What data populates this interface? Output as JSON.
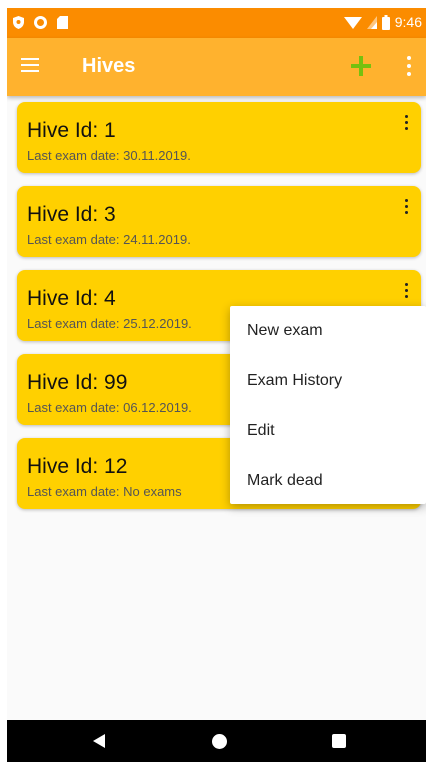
{
  "status_bar": {
    "time": "9:46",
    "icons": [
      "shield-icon",
      "circle-icon",
      "sd-card-icon",
      "wifi-icon",
      "signal-icon",
      "battery-icon"
    ]
  },
  "app_bar": {
    "title": "Hives",
    "icons": [
      "menu-icon",
      "add-icon",
      "overflow-menu-icon"
    ]
  },
  "colors": {
    "status_bar": "#fb8c00",
    "app_bar": "#ffb22e",
    "card": "#ffd000",
    "add_icon": "#76c10f"
  },
  "hives": [
    {
      "title": "Hive Id: 1",
      "last_exam": "Last exam date: 30.11.2019."
    },
    {
      "title": "Hive Id: 3",
      "last_exam": "Last exam date: 24.11.2019."
    },
    {
      "title": "Hive Id: 4",
      "last_exam": "Last exam date: 25.12.2019."
    },
    {
      "title": "Hive Id: 99",
      "last_exam": "Last exam date: 06.12.2019."
    },
    {
      "title": "Hive Id: 12",
      "last_exam": "Last exam date: No exams"
    }
  ],
  "popup_menu": {
    "items": [
      "New exam",
      "Exam History",
      "Edit",
      "Mark dead"
    ]
  },
  "nav_bar": {
    "icons": [
      "back-icon",
      "home-icon",
      "recent-apps-icon"
    ]
  }
}
